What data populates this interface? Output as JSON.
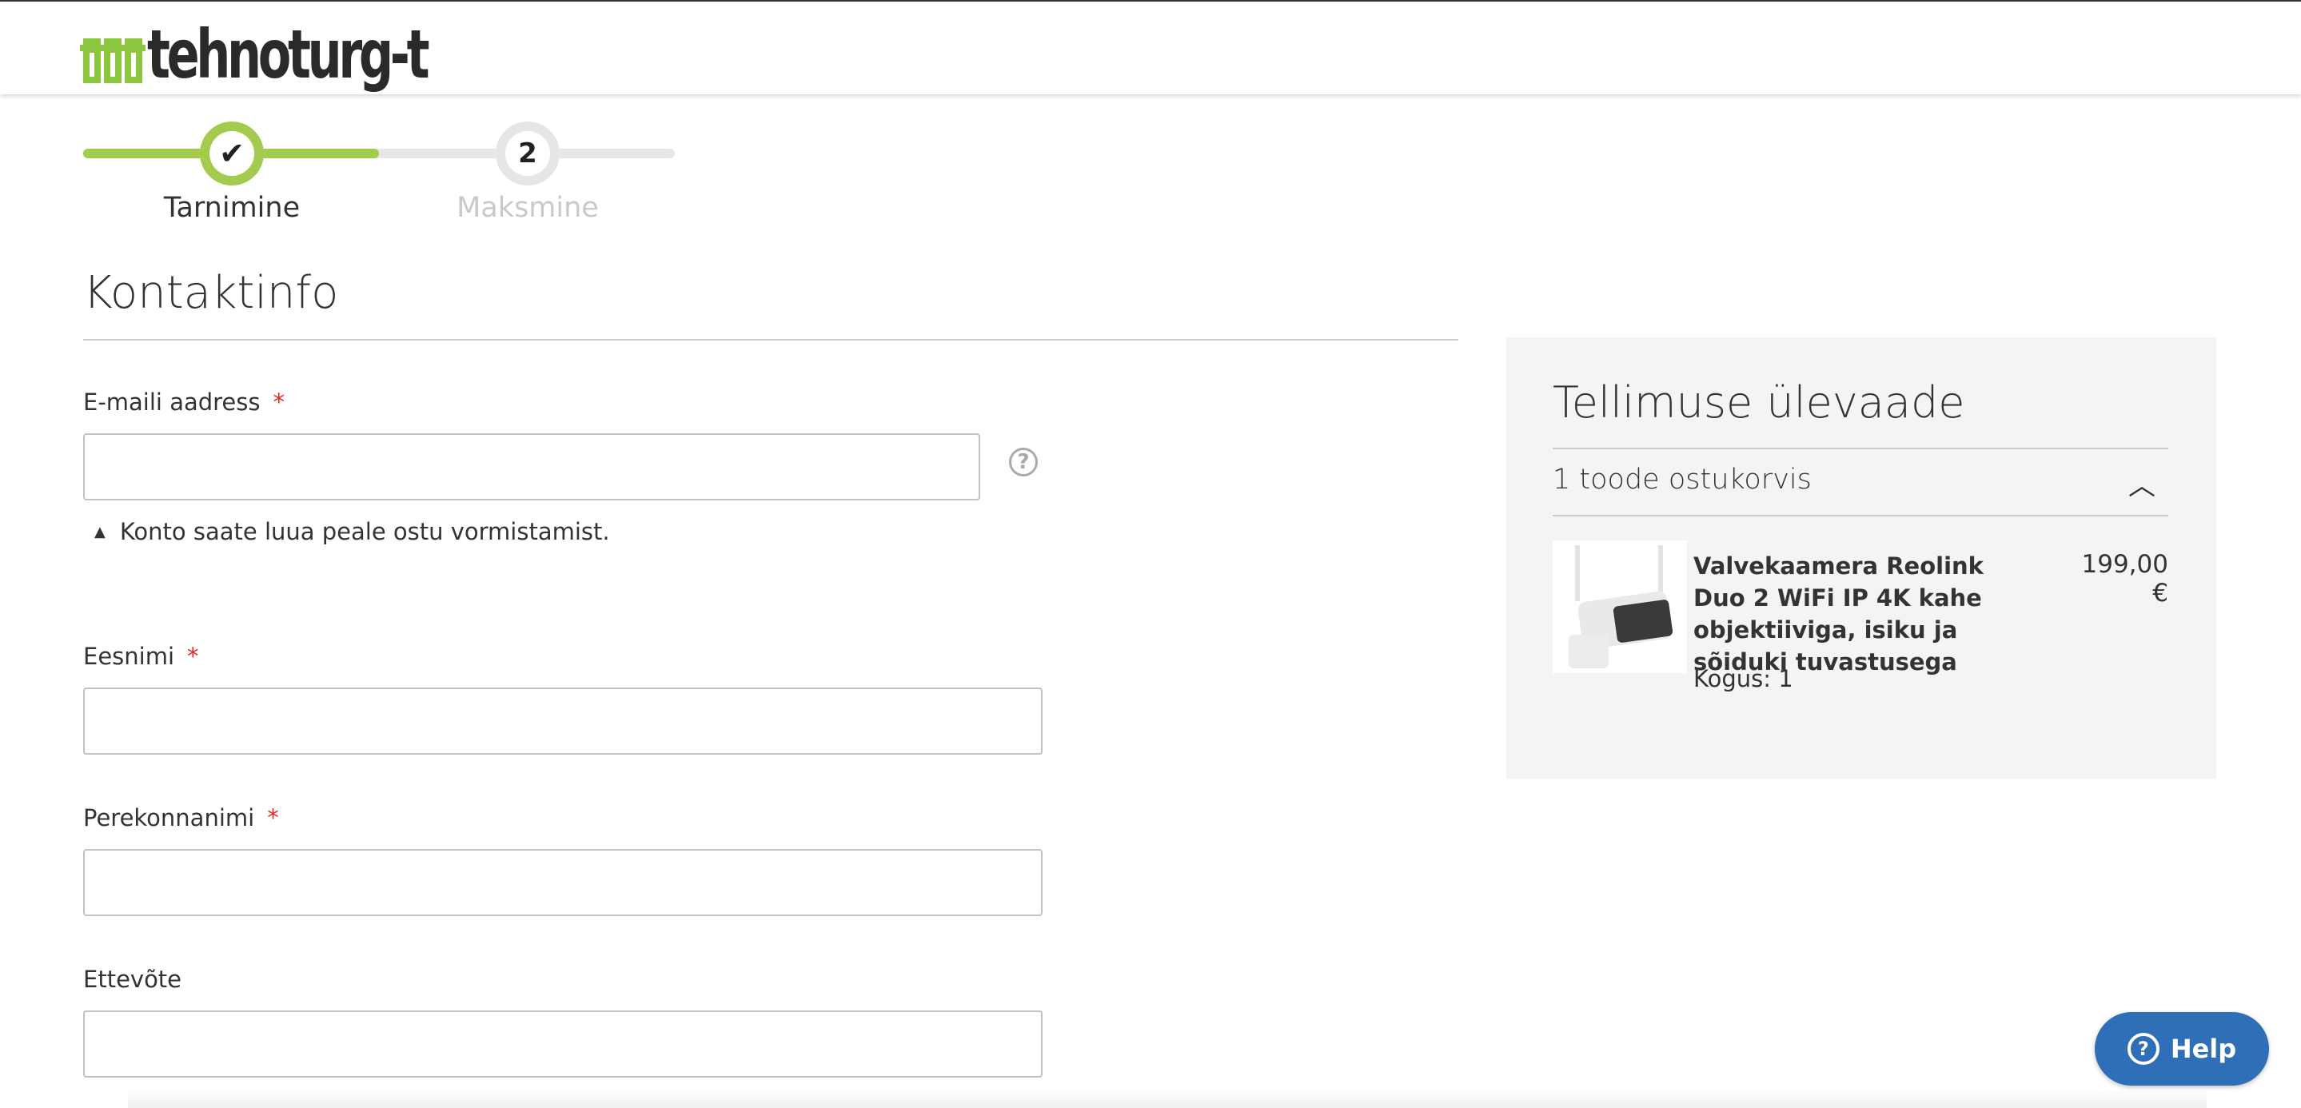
{
  "header": {
    "logo_text": "tehnoturg-t"
  },
  "progress": {
    "steps": [
      {
        "label": "Tarnimine",
        "marker": "✔",
        "state": "done"
      },
      {
        "label": "Maksmine",
        "marker": "2",
        "state": "upcoming"
      }
    ],
    "completed_fraction": 0.5
  },
  "contact": {
    "title": "Kontaktinfo",
    "email_label": "E-maili aadress",
    "required_mark": "*",
    "email_value": "",
    "help_icon": "?",
    "account_note": "Konto saate luua peale ostu vormistamist.",
    "first_name_label": "Eesnimi",
    "first_name_value": "",
    "last_name_label": "Perekonnanimi",
    "last_name_value": "",
    "company_label": "Ettevõte",
    "company_value": ""
  },
  "summary": {
    "title": "Tellimuse ülevaade",
    "cart_count": "1 toode ostukorvis",
    "items": [
      {
        "name": "Valvekaamera Reolink Duo 2 WiFi IP 4K kahe objektiiviga, isiku ja sõiduki tuvastusega",
        "price": "199,00 €",
        "qty": "Kogus: 1"
      }
    ]
  },
  "help_button": {
    "label": "Help",
    "icon": "?"
  },
  "colors": {
    "accent_green": "#a3cc4f",
    "help_blue": "#2f6fb7",
    "required_red": "#e02b27"
  }
}
